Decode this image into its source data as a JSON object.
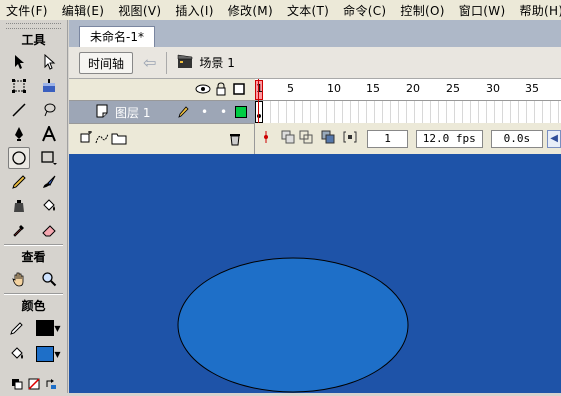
{
  "menu": [
    "文件(F)",
    "编辑(E)",
    "视图(V)",
    "插入(I)",
    "修改(M)",
    "文本(T)",
    "命令(C)",
    "控制(O)",
    "窗口(W)",
    "帮助(H)"
  ],
  "toolbox": {
    "tools_title": "工具",
    "view_title": "查看",
    "colors_title": "颜色",
    "stroke_color": "#000000",
    "fill_color": "#1e6fc8"
  },
  "document": {
    "tab_title": "未命名-1*",
    "timeline_button": "时间轴",
    "scene_label": "场景 1"
  },
  "timeline": {
    "layer_name": "图层 1",
    "layer_color": "#00cc44",
    "ruler_marks": [
      "1",
      "5",
      "10",
      "15",
      "20",
      "25",
      "30",
      "35"
    ],
    "current_frame": "1",
    "frame_rate": "12.0 fps",
    "elapsed_time": "0.0s"
  },
  "stage": {
    "background_color": "#1e53a8",
    "ellipse_fill": "#1e6fc8",
    "ellipse_stroke": "#000000"
  }
}
